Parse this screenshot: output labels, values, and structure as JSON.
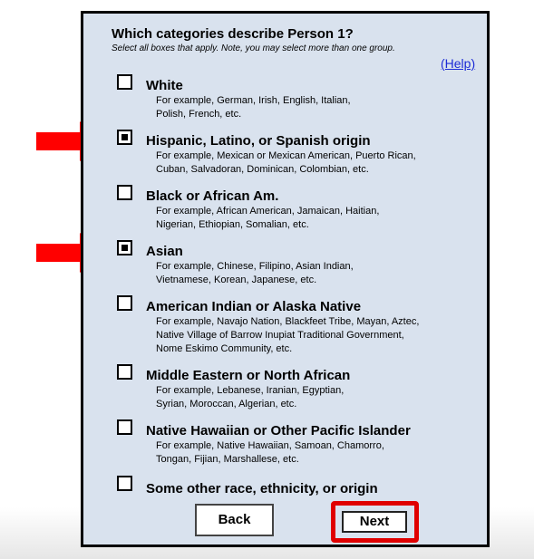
{
  "form": {
    "heading": "Which categories describe Person 1?",
    "subheading": "Select all boxes that apply. Note, you may select more than one group.",
    "help_label": "(Help)"
  },
  "options": [
    {
      "label": "White",
      "checked": false,
      "desc": [
        "For example, German, Irish, English, Italian,",
        "Polish, French, etc."
      ]
    },
    {
      "label": "Hispanic, Latino, or Spanish origin",
      "checked": true,
      "desc": [
        "For example, Mexican or Mexican American, Puerto Rican,",
        "Cuban, Salvadoran, Dominican, Colombian, etc."
      ]
    },
    {
      "label": "Black or African Am.",
      "checked": false,
      "desc": [
        "For example, African American, Jamaican, Haitian,",
        "Nigerian, Ethiopian, Somalian, etc."
      ]
    },
    {
      "label": "Asian",
      "checked": true,
      "desc": [
        "For example, Chinese, Filipino, Asian Indian,",
        "Vietnamese, Korean, Japanese, etc."
      ]
    },
    {
      "label": "American Indian or Alaska Native",
      "checked": false,
      "desc": [
        "For example, Navajo Nation, Blackfeet Tribe, Mayan, Aztec,",
        "Native Village of Barrow Inupiat Traditional Government,",
        "Nome Eskimo Community, etc."
      ]
    },
    {
      "label": "Middle Eastern or North African",
      "checked": false,
      "desc": [
        "For example, Lebanese, Iranian, Egyptian,",
        "Syrian, Moroccan, Algerian, etc."
      ]
    },
    {
      "label": "Native Hawaiian or Other Pacific Islander",
      "checked": false,
      "desc": [
        "For example, Native Hawaiian, Samoan, Chamorro,",
        "Tongan, Fijian, Marshallese, etc."
      ]
    },
    {
      "label": "Some other race, ethnicity, or origin",
      "checked": false,
      "desc": []
    }
  ],
  "buttons": {
    "back_label": "Back",
    "next_label": "Next"
  },
  "colors": {
    "panel_bg": "#d9e2ee",
    "arrow": "#ff0000",
    "highlight": "#e00000",
    "help_link": "#1c2bd6"
  }
}
